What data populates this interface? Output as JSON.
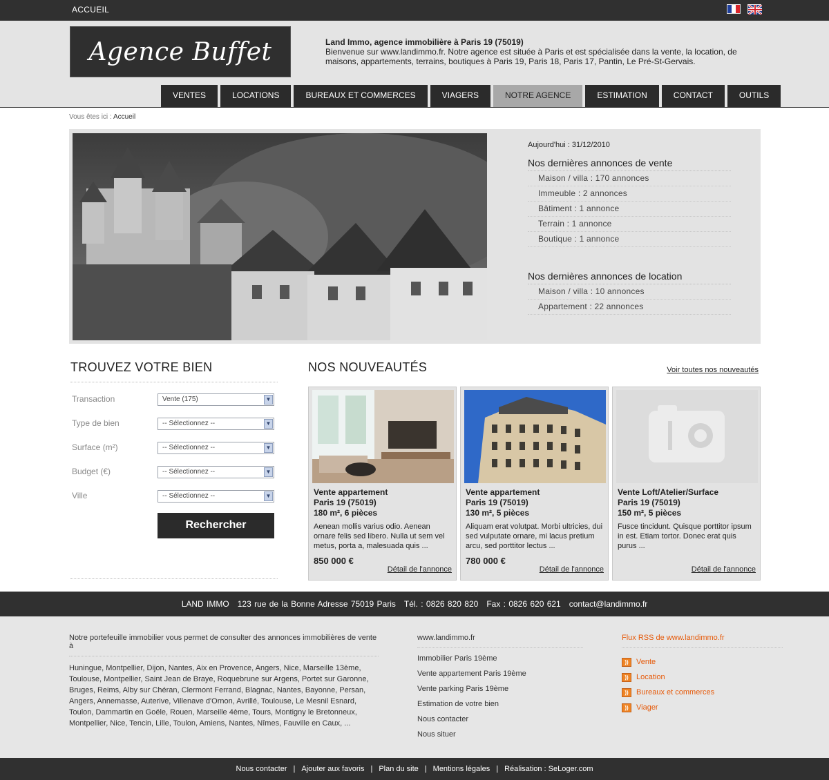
{
  "topbar": {
    "home": "ACCUEIL"
  },
  "header": {
    "logo": "Agence Buffet",
    "intro_title": "Land Immo, agence immobilière à Paris 19 (75019)",
    "intro_text": "Bienvenue sur www.landimmo.fr. Notre agence est située à Paris et est spécialisée dans la vente, la location, de maisons, appartements, terrains, boutiques à Paris 19, Paris 18, Paris 17, Pantin, Le Pré-St-Gervais."
  },
  "nav": [
    "VENTES",
    "LOCATIONS",
    "BUREAUX ET COMMERCES",
    "VIAGERS",
    "NOTRE AGENCE",
    "ESTIMATION",
    "CONTACT",
    "OUTILS"
  ],
  "breadcrumb": {
    "prefix": "Vous êtes ici :",
    "current": "Accueil"
  },
  "hero": {
    "today": "Aujourd'hui : 31/12/2010",
    "sale_title": "Nos dernières annonces de vente",
    "sale_items": [
      "Maison / villa : 170 annonces",
      "Immeuble : 2 annonces",
      "Bâtiment : 1 annonce",
      "Terrain : 1 annonce",
      "Boutique : 1 annonce"
    ],
    "rent_title": "Nos dernières annonces de location",
    "rent_items": [
      "Maison / villa : 10 annonces",
      "Appartement : 22 annonces"
    ]
  },
  "search": {
    "title": "TROUVEZ VOTRE BIEN",
    "fields": [
      {
        "label": "Transaction",
        "value": "Vente (175)"
      },
      {
        "label": "Type de bien",
        "value": "-- Sélectionnez --"
      },
      {
        "label": "Surface (m²)",
        "value": "-- Sélectionnez --"
      },
      {
        "label": "Budget (€)",
        "value": "-- Sélectionnez --"
      },
      {
        "label": "Ville",
        "value": "-- Sélectionnez --"
      }
    ],
    "button": "Rechercher"
  },
  "news": {
    "title": "NOS NOUVEAUTÉS",
    "view_all": "Voir toutes nos nouveautés",
    "cards": [
      {
        "type": "Vente appartement",
        "city": "Paris 19 (75019)",
        "size": "180 m², 6 pièces",
        "desc": "Aenean mollis varius odio. Aenean ornare felis sed libero. Nulla ut sem vel metus, porta a, malesuada quis ...",
        "price": "850 000 €",
        "detail": "Détail de l'annonce"
      },
      {
        "type": "Vente appartement",
        "city": "Paris 19 (75019)",
        "size": "130 m², 5 pièces",
        "desc": "Aliquam erat volutpat. Morbi ultricies, dui sed vulputate ornare, mi lacus pretium arcu, sed porttitor lectus ...",
        "price": "780 000 €",
        "detail": "Détail de l'annonce"
      },
      {
        "type": "Vente Loft/Atelier/Surface",
        "city": "Paris 19 (75019)",
        "size": "150 m², 5 pièces",
        "desc": "Fusce tincidunt. Quisque porttitor ipsum in est. Etiam tortor. Donec erat quis purus ...",
        "price": "",
        "detail": "Détail de l'annonce"
      }
    ]
  },
  "contactbar": {
    "name": "LAND IMMO",
    "address": "123 rue de la Bonne Adresse 75019 Paris",
    "tel": "Tél. : 0826 820 820",
    "fax": "Fax : 0826 620 621",
    "email": "contact@landimmo.fr"
  },
  "footer": {
    "portfolio_title": "Notre portefeuille immobilier vous permet de consulter des annonces immobilières de vente à",
    "cities": "Huningue, Montpellier, Dijon, Nantes, Aix en Provence, Angers, Nice, Marseille 13ème, Toulouse, Montpellier, Saint Jean de Braye, Roquebrune sur Argens, Portet sur Garonne, Bruges, Reims, Alby sur Chéran, Clermont Ferrand, Blagnac, Nantes, Bayonne, Persan, Angers, Annemasse, Auterive, Villenave d'Ornon, Avrillé, Toulouse, Le Mesnil Esnard, Toulon, Dammartin en Goële, Rouen, Marseille 4ème, Tours, Montigny le Bretonneux, Montpellier, Nice, Tencin, Lille, Toulon, Amiens, Nantes, Nîmes, Fauville en Caux, ...",
    "site_title": "www.landimmo.fr",
    "site_links": [
      "Immobilier Paris 19ème",
      "Vente appartement Paris 19ème",
      "Vente parking Paris 19ème",
      "Estimation de votre bien",
      "Nous contacter",
      "Nous situer"
    ],
    "rss_title": "Flux RSS de www.landimmo.fr",
    "rss_links": [
      "Vente",
      "Location",
      "Bureaux et commerces",
      "Viager"
    ]
  },
  "bottombar": [
    "Nous contacter",
    "Ajouter aux favoris",
    "Plan du site",
    "Mentions légales",
    "Réalisation : SeLoger.com"
  ],
  "colors": {
    "dark": "#303030",
    "accent_rss": "#e65a0a",
    "panel": "#e3e3e3"
  }
}
